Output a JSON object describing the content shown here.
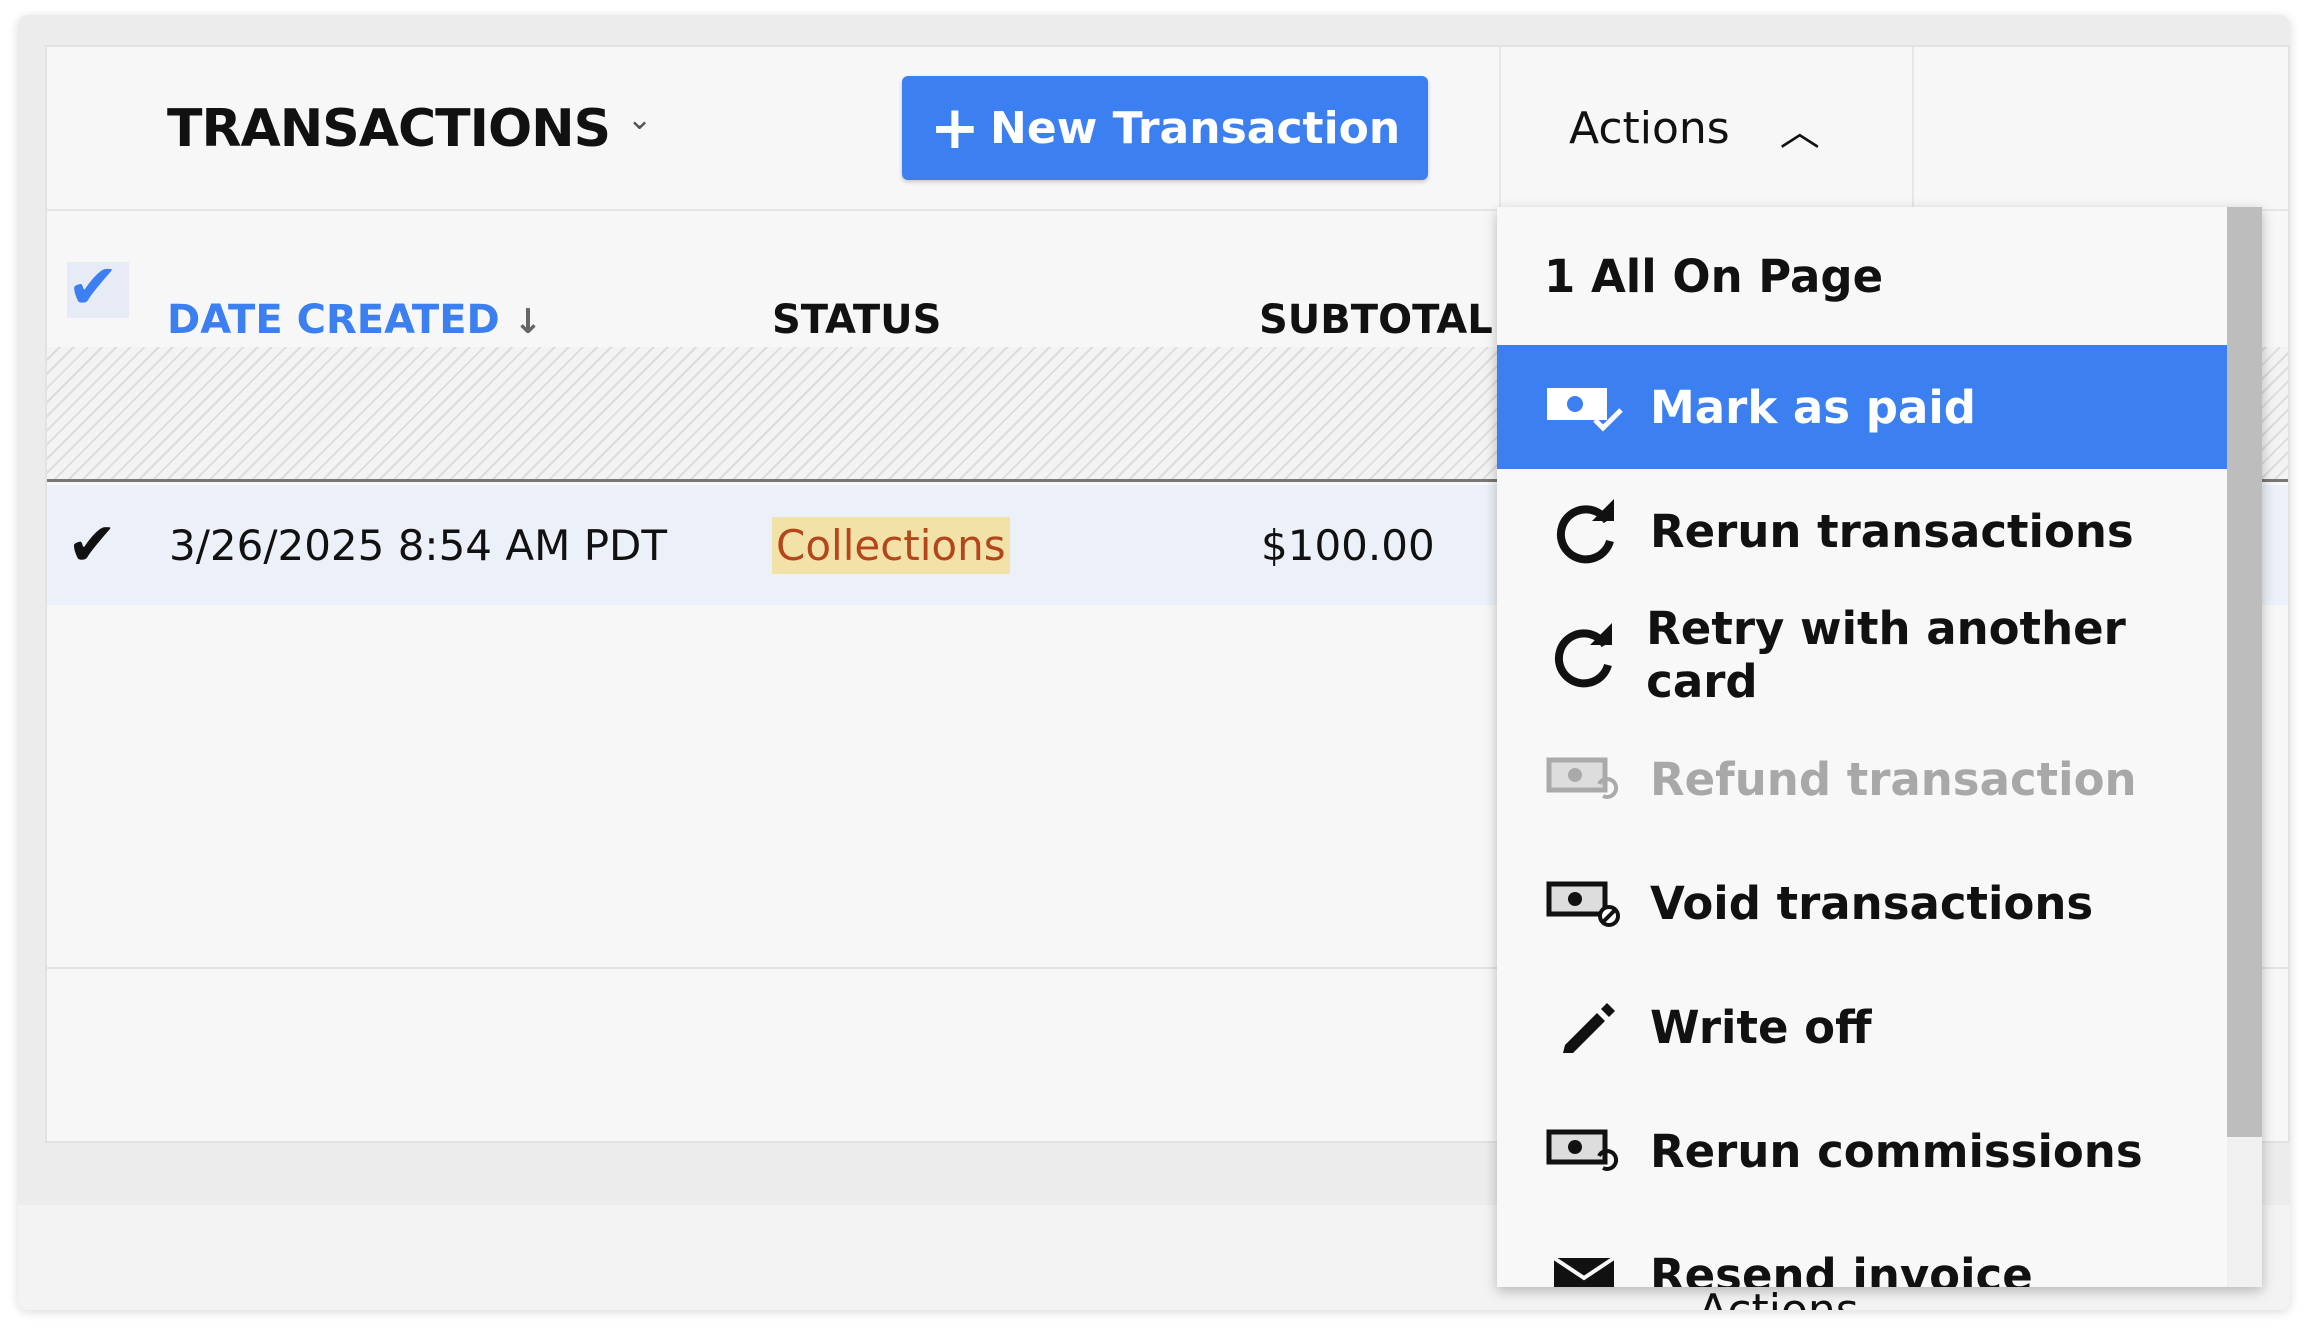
{
  "header": {
    "title": "TRANSACTIONS",
    "new_button": "New Transaction",
    "actions_label": "Actions"
  },
  "columns": {
    "date_created": "DATE CREATED",
    "status": "STATUS",
    "subtotal": "SUBTOTAL"
  },
  "row": {
    "date": "3/26/2025 8:54 AM PDT",
    "status": "Collections",
    "subtotal": "$100.00",
    "selected": true
  },
  "menu": {
    "select_all": "1 All On Page",
    "items": [
      {
        "label": "Mark as paid",
        "icon": "money-check-icon",
        "state": "highlighted"
      },
      {
        "label": "Rerun transactions",
        "icon": "refresh-icon",
        "state": "enabled"
      },
      {
        "label": "Retry with another card",
        "icon": "refresh-icon",
        "state": "enabled"
      },
      {
        "label": "Refund transaction",
        "icon": "money-undo-icon",
        "state": "disabled"
      },
      {
        "label": "Void transactions",
        "icon": "money-void-icon",
        "state": "enabled"
      },
      {
        "label": "Write off",
        "icon": "pencil-icon",
        "state": "enabled"
      },
      {
        "label": "Rerun commissions",
        "icon": "money-undo-icon",
        "state": "enabled"
      },
      {
        "label": "Resend invoice",
        "icon": "envelope-icon",
        "state": "enabled"
      }
    ]
  },
  "footer": {
    "actions_label": "Actions"
  },
  "colors": {
    "accent": "#3b7ff0",
    "badge_bg": "#f3e2a8",
    "badge_text": "#b4461b",
    "row_selected": "#ecf0f8"
  }
}
